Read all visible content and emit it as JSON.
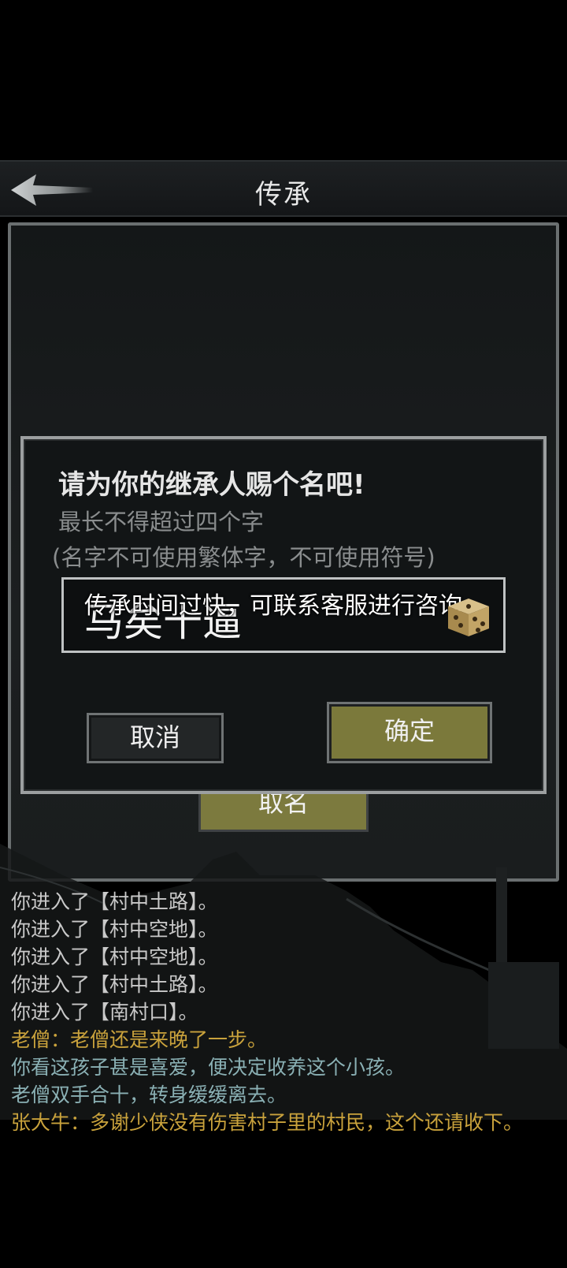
{
  "header": {
    "back_icon": "back-arrow-icon",
    "title": "传承"
  },
  "panel": {
    "name_button_label": "取名"
  },
  "dialog": {
    "title": "请为你的继承人赐个名吧!",
    "hint": "最长不得超过四个字",
    "rule": "(名字不可使用繁体字，不可使用符号)",
    "input_value": "马矣十逼",
    "toast": "传承时间过快，可联系客服进行咨询",
    "dice_icon": "dice-icon",
    "cancel_label": "取消",
    "confirm_label": "确定"
  },
  "log": [
    {
      "text": "你进入了【村中土路】。",
      "color": "white"
    },
    {
      "text": "你进入了【村中空地】。",
      "color": "white"
    },
    {
      "text": "你进入了【村中空地】。",
      "color": "white"
    },
    {
      "text": "你进入了【村中土路】。",
      "color": "white"
    },
    {
      "text": "你进入了【南村口】。",
      "color": "white"
    },
    {
      "text": "老僧：老僧还是来晚了一步。",
      "color": "gold"
    },
    {
      "text": "你看这孩子甚是喜爱，便决定收养这个小孩。",
      "color": "teal"
    },
    {
      "text": "老僧双手合十，转身缓缓离去。",
      "color": "teal"
    },
    {
      "text": "张大牛：多谢少侠没有伤害村子里的村民，这个还请收下。",
      "color": "gold"
    }
  ],
  "colors": {
    "gold": "#c9a23c",
    "teal": "#8ab0b4",
    "button_olive": "#7b793b"
  }
}
